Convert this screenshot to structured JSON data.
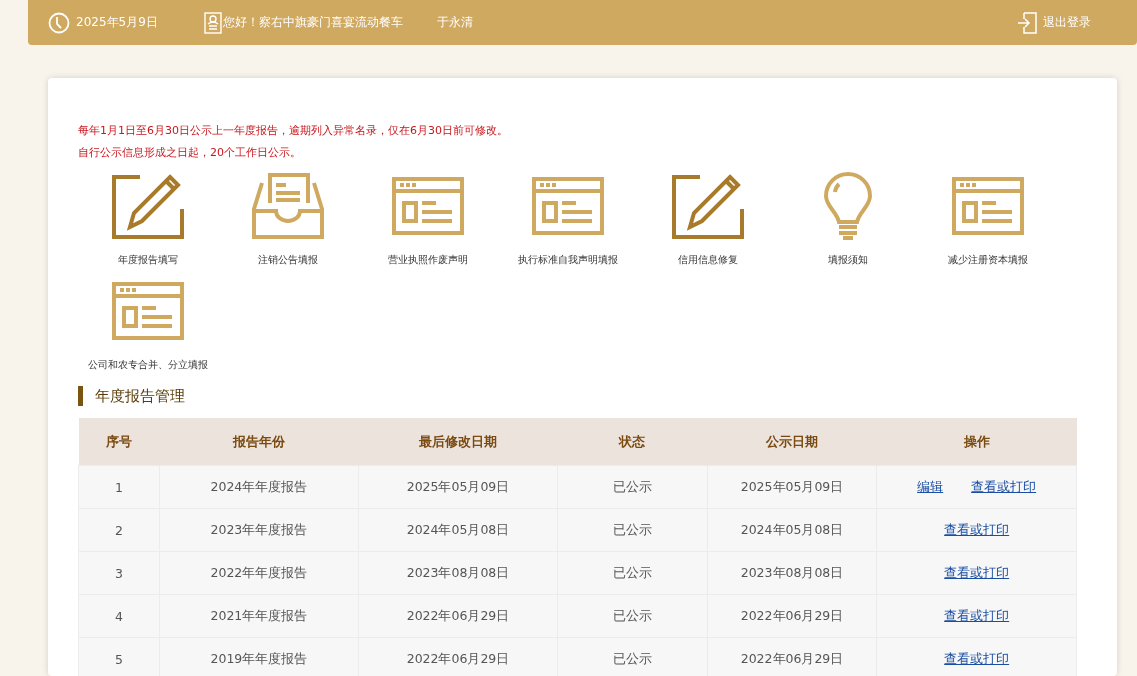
{
  "header": {
    "date": "2025年5月9日",
    "greeting": "您好！察右中旗豪门喜宴流动餐车",
    "user": "于永清",
    "logout": "退出登录"
  },
  "notices": [
    "每年1月1日至6月30日公示上一年度报告，逾期列入异常名录，仅在6月30日前可修改。",
    "自行公示信息形成之日起，20个工作日公示。"
  ],
  "services": [
    {
      "kind": "edit",
      "label": "年度报告填写"
    },
    {
      "kind": "inbox",
      "label": "注销公告填报"
    },
    {
      "kind": "form",
      "label": "营业执照作废声明"
    },
    {
      "kind": "form",
      "label": "执行标准自我声明填报"
    },
    {
      "kind": "edit",
      "label": "信用信息修复"
    },
    {
      "kind": "bulb",
      "label": "填报须知"
    },
    {
      "kind": "form",
      "label": "减少注册资本填报"
    },
    {
      "kind": "form",
      "label": "公司和农专合并、分立填报"
    }
  ],
  "section_title": "年度报告管理",
  "table": {
    "columns": [
      "序号",
      "报告年份",
      "最后修改日期",
      "状态",
      "公示日期",
      "操作"
    ],
    "rows": [
      {
        "cells": [
          "1",
          "2024年年度报告",
          "2025年05月09日",
          "已公示",
          "2025年05月09日"
        ],
        "actions": [
          "编辑",
          "查看或打印"
        ]
      },
      {
        "cells": [
          "2",
          "2023年年度报告",
          "2024年05月08日",
          "已公示",
          "2024年05月08日"
        ],
        "actions": [
          "查看或打印"
        ]
      },
      {
        "cells": [
          "3",
          "2022年年度报告",
          "2023年08月08日",
          "已公示",
          "2023年08月08日"
        ],
        "actions": [
          "查看或打印"
        ]
      },
      {
        "cells": [
          "4",
          "2021年年度报告",
          "2022年06月29日",
          "已公示",
          "2022年06月29日"
        ],
        "actions": [
          "查看或打印"
        ]
      },
      {
        "cells": [
          "5",
          "2019年年度报告",
          "2022年06月29日",
          "已公示",
          "2022年06月29日"
        ],
        "actions": [
          "查看或打印"
        ]
      }
    ]
  }
}
